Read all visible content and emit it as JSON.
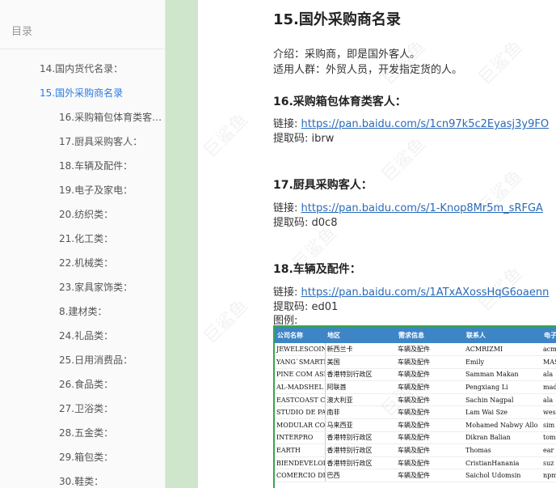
{
  "sidebar": {
    "title": "目录",
    "items": [
      {
        "label": "14.国内货代名录：",
        "level": 1,
        "active": false
      },
      {
        "label": "15.国外采购商名录",
        "level": 1,
        "active": true
      },
      {
        "label": "16.采购箱包体育类客人：",
        "level": 2,
        "active": false
      },
      {
        "label": "17.厨具采购客人：",
        "level": 2,
        "active": false
      },
      {
        "label": "18.车辆及配件：",
        "level": 2,
        "active": false
      },
      {
        "label": "19.电子及家电：",
        "level": 2,
        "active": false
      },
      {
        "label": "20.纺织类：",
        "level": 2,
        "active": false
      },
      {
        "label": "21.化工类：",
        "level": 2,
        "active": false
      },
      {
        "label": "22.机械类：",
        "level": 2,
        "active": false
      },
      {
        "label": "23.家具家饰类：",
        "level": 2,
        "active": false
      },
      {
        "label": "8.建材类：",
        "level": 2,
        "active": false
      },
      {
        "label": "24.礼品类：",
        "level": 2,
        "active": false
      },
      {
        "label": "25.日用消费品：",
        "level": 2,
        "active": false
      },
      {
        "label": "26.食品类：",
        "level": 2,
        "active": false
      },
      {
        "label": "27.卫浴类：",
        "level": 2,
        "active": false
      },
      {
        "label": "28.五金类：",
        "level": 2,
        "active": false
      },
      {
        "label": "29.箱包类：",
        "level": 2,
        "active": false
      },
      {
        "label": "30.鞋类：",
        "level": 2,
        "active": false
      }
    ]
  },
  "content": {
    "title": "15.国外采购商名录",
    "intro": "介绍：采购商，即是国外客人。",
    "audience": "适用人群：外贸人员，开发指定货的人。",
    "link_label": "链接:",
    "code_label": "提取码:",
    "example_label": "图例:",
    "sections": [
      {
        "heading": "16.采购箱包体育类客人：",
        "url": "https://pan.baidu.com/s/1cn97k5c2Eyasj3y9FO",
        "code": "ibrw"
      },
      {
        "heading": "17.厨具采购客人：",
        "url": "https://pan.baidu.com/s/1-Knop8Mr5m_sRFGA",
        "code": "d0c8"
      },
      {
        "heading": "18.车辆及配件：",
        "url": "https://pan.baidu.com/s/1ATxAXossHqG6oaenn",
        "code": "ed01"
      }
    ]
  },
  "watermark": "巨鲨鱼",
  "example_table": {
    "headers": [
      "公司名称",
      "地区",
      "需求信息",
      "联系人",
      "电子"
    ],
    "rows": [
      [
        "JEWELESCOINT",
        "新西兰卡",
        "车辆及配件",
        "ACMRIZMI",
        "acm"
      ],
      [
        "YANG`SMARTI/",
        "美国",
        "车辆及配件",
        "Emily",
        "MAS"
      ],
      [
        "PINE COM ASI",
        "香港特别行政区",
        "车辆及配件",
        "Samman Makan",
        "ala"
      ],
      [
        "AL-MADSHEL 1",
        "阿联酋",
        "车辆及配件",
        "Pengxiang Li",
        "mad"
      ],
      [
        "EASTCOAST CC",
        "澳大利亚",
        "车辆及配件",
        "Sachin Nagpal",
        "ala"
      ],
      [
        "STUDIO DE PA",
        "南非",
        "车辆及配件",
        "Lam Wai Sze",
        "wes"
      ],
      [
        "MODULAR CONS",
        "马来西亚",
        "车辆及配件",
        "Mohamed Nabwy Allo",
        "sim"
      ],
      [
        "INTERPRO",
        "香港特别行政区",
        "车辆及配件",
        "Dikran Balian",
        "tom"
      ],
      [
        "EARTH",
        "香港特别行政区",
        "车辆及配件",
        "Thomas",
        "ear"
      ],
      [
        "BIENDEVELOPM",
        "香港特别行政区",
        "车辆及配件",
        "CristianHanania",
        "suz"
      ],
      [
        "COMERCIO DE",
        "巴西",
        "车辆及配件",
        "Saichol Udomsin",
        "npm"
      ]
    ]
  }
}
